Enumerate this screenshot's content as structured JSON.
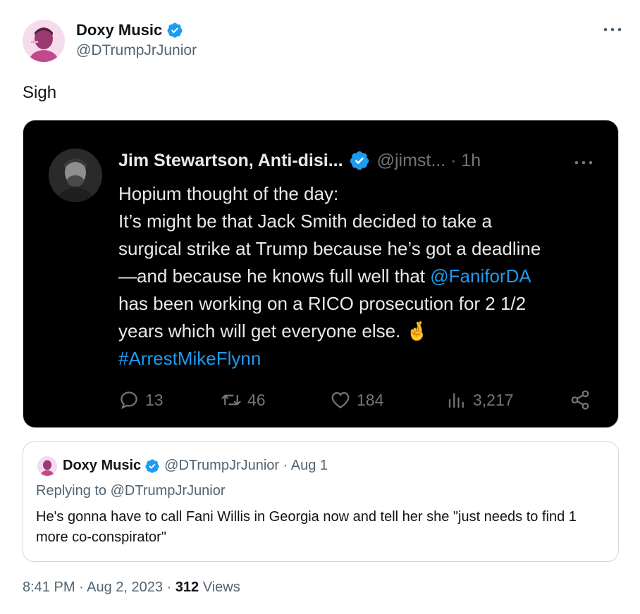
{
  "author": {
    "display_name": "Doxy Music",
    "handle": "@DTrumpJrJunior",
    "avatar_icon": "avatar-photo",
    "verified_icon": "verified-badge-icon"
  },
  "tweet": {
    "text": "Sigh"
  },
  "screenshot": {
    "name": "Jim Stewartson, Anti-disi...",
    "handle_time": "@jimst... · 1h",
    "lines": [
      "Hopium thought of the day:",
      "It’s might be that Jack Smith decided to take a",
      "surgical strike at Trump because he’s got a deadline",
      "—and because he knows full well that ",
      "has been working on a RICO prosecution for 2 1/2",
      "years which will get everyone else. "
    ],
    "mention": "@FaniforDA",
    "hashtag": "#ArrestMikeFlynn",
    "emoji": "🤞",
    "replies": "13",
    "retweets": "46",
    "likes": "184",
    "views": "3,217"
  },
  "quoted": {
    "display_name": "Doxy Music",
    "handle_date": "@DTrumpJrJunior · Aug 1",
    "replying_to": "Replying to @DTrumpJrJunior",
    "text": "He's gonna have to call Fani Willis in Georgia now and  tell her she \"just needs to find 1 more co-conspirator\""
  },
  "footer": {
    "time_date": "8:41 PM · Aug 2, 2023 · ",
    "views_count": "312",
    "views_label": " Views"
  },
  "colors": {
    "accent": "#1d9bf0",
    "text": "#0f1419",
    "secondary": "#536471"
  }
}
